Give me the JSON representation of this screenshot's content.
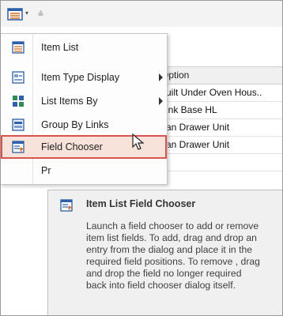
{
  "quick_access": {
    "dropdown_glyph": "▾",
    "separator_glyph": "⩮"
  },
  "grid": {
    "header": "Option",
    "rows": [
      "Built Under Oven Hous..",
      "Sink Base HL",
      "Pan Drawer Unit",
      "Pan Drawer Unit",
      "..."
    ]
  },
  "menu": {
    "items": [
      {
        "label": "Item List",
        "icon": "item-list-icon"
      },
      {
        "label": "Item Type Display",
        "icon": "item-type-display-icon",
        "has_submenu": true
      },
      {
        "label": "List Items By",
        "icon": "list-items-by-icon",
        "has_submenu": true
      },
      {
        "label": "Group By Links",
        "icon": "group-by-links-icon"
      },
      {
        "label": "Field Chooser",
        "icon": "field-chooser-icon",
        "selected": true
      },
      {
        "label": "Pr",
        "icon": "partial-menu-icon"
      }
    ]
  },
  "tooltip": {
    "title": "Item List Field Chooser",
    "body": "Launch a field chooser to add or remove item list fields. To add, drag and drop an entry from the dialog and place it in the required field positions. To remove , drag and drop the field no longer required back into field chooser dialog itself."
  },
  "colors": {
    "accent_red": "#d9534f",
    "selected_bg": "#f7e3da"
  }
}
